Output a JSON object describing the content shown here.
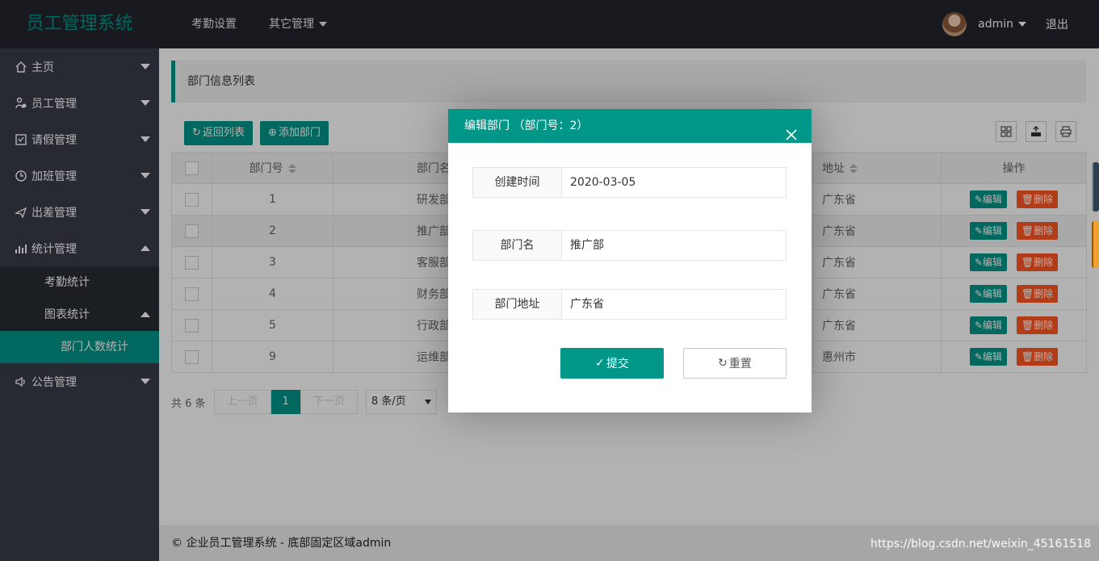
{
  "header": {
    "logo": "员工管理系统",
    "nav": [
      {
        "label": "考勤设置"
      },
      {
        "label": "其它管理"
      }
    ],
    "user": "admin",
    "logout": "退出"
  },
  "sidebar": {
    "items": [
      {
        "label": "主页",
        "icon": "home-icon"
      },
      {
        "label": "员工管理",
        "icon": "employee-icon"
      },
      {
        "label": "请假管理",
        "icon": "leave-icon"
      },
      {
        "label": "加班管理",
        "icon": "overtime-icon"
      },
      {
        "label": "出差管理",
        "icon": "plane-icon"
      },
      {
        "label": "统计管理",
        "icon": "chart-icon"
      },
      {
        "label": "公告管理",
        "icon": "speaker-icon"
      }
    ],
    "sub": {
      "attendance": "考勤统计",
      "charts": "图表统计",
      "dept_count": "部门人数统计"
    }
  },
  "main": {
    "title": "部门信息列表",
    "toolbar": {
      "back": "返回列表",
      "add": "添加部门"
    },
    "columns": {
      "id": "部门号",
      "name": "部门名",
      "address": "地址",
      "ops": "操作"
    },
    "rows": [
      {
        "id": "1",
        "name": "研发部",
        "address": "广东省"
      },
      {
        "id": "2",
        "name": "推广部",
        "address": "广东省"
      },
      {
        "id": "3",
        "name": "客服部",
        "address": "广东省"
      },
      {
        "id": "4",
        "name": "财务部",
        "address": "广东省"
      },
      {
        "id": "5",
        "name": "行政部",
        "address": "广东省"
      },
      {
        "id": "9",
        "name": "运维部",
        "address": "惠州市"
      }
    ],
    "row_actions": {
      "edit": "编辑",
      "delete": "删除"
    },
    "pager": {
      "total": "共 6 条",
      "prev": "上一页",
      "current": "1",
      "next": "下一页",
      "page_size": "8 条/页"
    }
  },
  "modal": {
    "title": "编辑部门 （部门号：2）",
    "fields": [
      {
        "label": "创建时间",
        "value": "2020-03-05"
      },
      {
        "label": "部门名",
        "value": "推广部"
      },
      {
        "label": "部门地址",
        "value": "广东省"
      }
    ],
    "submit": "提交",
    "reset": "重置"
  },
  "footer": "© 企业员工管理系统 - 底部固定区域admin",
  "watermark": "https://blog.csdn.net/weixin_45161518",
  "colors": {
    "accent": "#009688",
    "danger": "#ff5722",
    "header_bg": "#23262e",
    "sidebar_bg": "#393d49"
  }
}
